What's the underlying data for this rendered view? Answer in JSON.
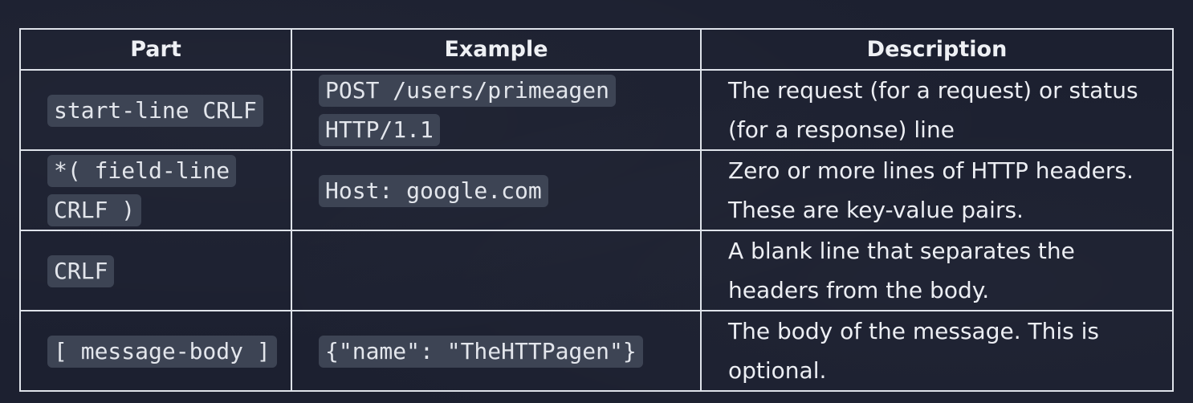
{
  "table": {
    "headers": {
      "part": "Part",
      "example": "Example",
      "description": "Description"
    },
    "rows": [
      {
        "part": "start-line CRLF",
        "example": "POST /users/primeagen HTTP/1.1",
        "description": "The request (for a request) or status (for a response) line"
      },
      {
        "part": "*( field-line CRLF )",
        "example": "Host: google.com",
        "description": "Zero or more lines of HTTP headers. These are key-value pairs."
      },
      {
        "part": "CRLF",
        "example": "",
        "description": "A blank line that separates the headers from the body."
      },
      {
        "part": "[ message-body ]",
        "example": "{\"name\": \"TheHTTPagen\"}",
        "description": "The body of the message. This is optional."
      }
    ]
  },
  "colors": {
    "background": "#1c2030",
    "border": "#dfe3ea",
    "code_background": "#3d4454",
    "text": "#eceef3"
  }
}
